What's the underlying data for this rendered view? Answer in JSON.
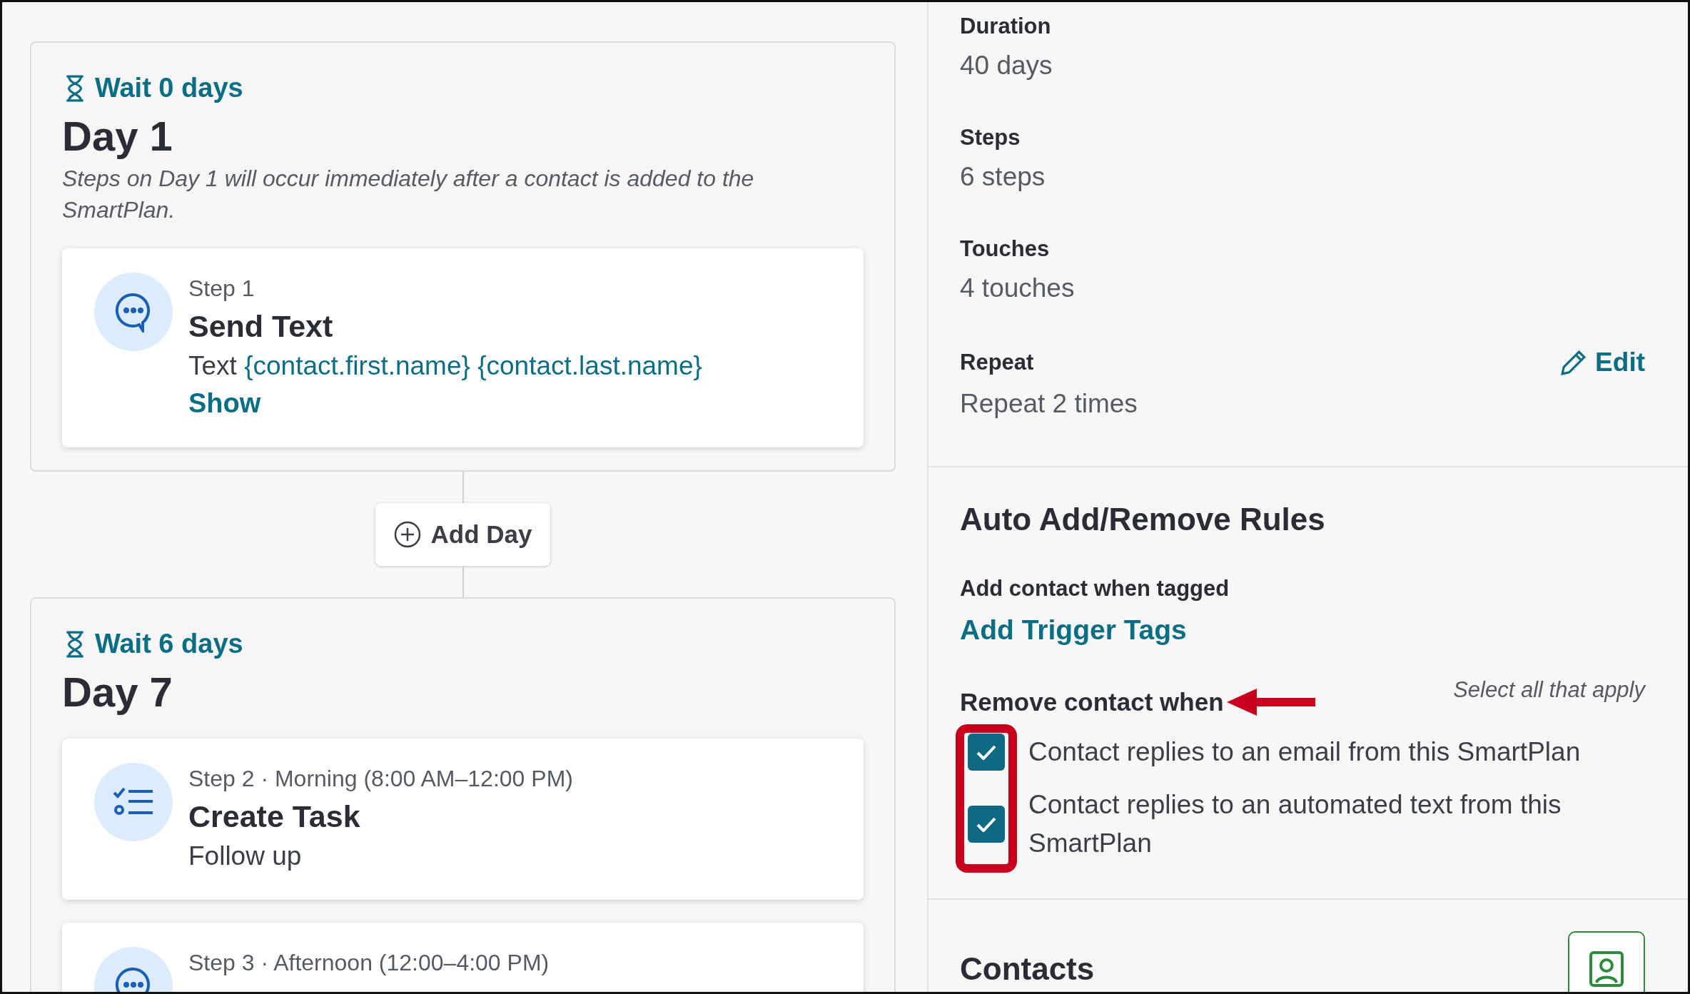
{
  "days": [
    {
      "wait": "Wait 0 days",
      "title": "Day 1",
      "note": "Steps on Day 1 will occur immediately after a contact is added to the SmartPlan.",
      "steps": [
        {
          "kind": "text",
          "meta": "Step 1",
          "title": "Send Text",
          "detail": "Text",
          "tokens": [
            "{contact.first.name}",
            "{contact.last.name}"
          ],
          "link": "Show"
        }
      ]
    },
    {
      "wait": "Wait 6 days",
      "title": "Day 7",
      "steps": [
        {
          "kind": "task",
          "meta": "Step 2 · Morning (8:00 AM–12:00 PM)",
          "title": "Create Task",
          "detail": "Follow up"
        },
        {
          "kind": "text",
          "meta": "Step 3 · Afternoon (12:00–4:00 PM)"
        }
      ]
    }
  ],
  "add_day_button": "Add Day",
  "details": [
    {
      "label": "Duration",
      "value": "40 days"
    },
    {
      "label": "Steps",
      "value": "6 steps"
    },
    {
      "label": "Touches",
      "value": "4 touches"
    },
    {
      "label": "Repeat",
      "value": "Repeat 2 times",
      "edit": "Edit"
    }
  ],
  "rules": {
    "title": "Auto Add/Remove Rules",
    "add_label": "Add contact when tagged",
    "add_link": "Add Trigger Tags",
    "remove_label": "Remove contact when",
    "hint": "Select all that apply",
    "options": [
      {
        "label": "Contact replies to an email from this SmartPlan",
        "checked": true
      },
      {
        "label": "Contact replies to an automated text from this SmartPlan",
        "checked": true
      }
    ]
  },
  "contacts": {
    "title": "Contacts"
  }
}
